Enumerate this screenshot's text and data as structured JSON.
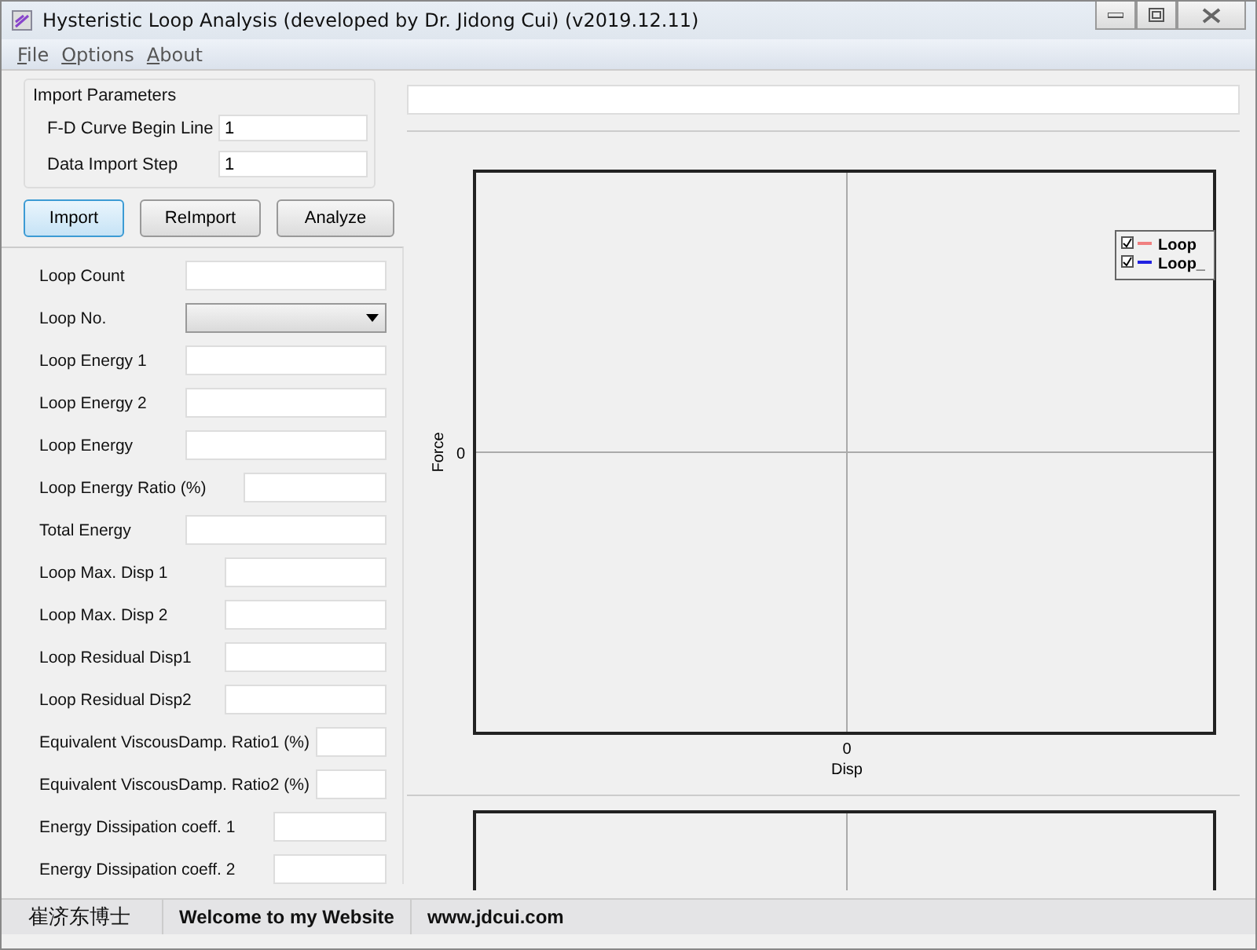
{
  "window": {
    "title": "Hysteristic Loop Analysis (developed by Dr. Jidong Cui) (v2019.12.11)"
  },
  "menu": [
    {
      "label": "File"
    },
    {
      "label": "Options"
    },
    {
      "label": "About"
    }
  ],
  "import_parameters": {
    "title": "Import Parameters",
    "fields": [
      {
        "label": "F-D Curve Begin Line",
        "value": "1"
      },
      {
        "label": "Data Import Step",
        "value": "1"
      }
    ]
  },
  "buttons": [
    {
      "label": "Import",
      "selected": true
    },
    {
      "label": "ReImport",
      "selected": false
    },
    {
      "label": "Analyze",
      "selected": false
    }
  ],
  "results": [
    {
      "label": "Loop Count",
      "kind": "text"
    },
    {
      "label": "Loop No.",
      "kind": "dropdown"
    },
    {
      "label": "Loop Energy 1",
      "kind": "text"
    },
    {
      "label": "Loop Energy 2",
      "kind": "text"
    },
    {
      "label": "Loop Energy",
      "kind": "text"
    },
    {
      "label": "Loop Energy Ratio (%)",
      "kind": "text"
    },
    {
      "label": "Total Energy",
      "kind": "text"
    },
    {
      "label": "Loop Max. Disp 1",
      "kind": "text"
    },
    {
      "label": "Loop Max. Disp 2",
      "kind": "text"
    },
    {
      "label": "Loop Residual Disp1",
      "kind": "text"
    },
    {
      "label": "Loop Residual Disp2",
      "kind": "text"
    },
    {
      "label": "Equivalent ViscousDamp. Ratio1 (%)",
      "kind": "text"
    },
    {
      "label": "Equivalent ViscousDamp. Ratio2 (%)",
      "kind": "text"
    },
    {
      "label": "Energy Dissipation coeff. 1",
      "kind": "text"
    },
    {
      "label": "Energy Dissipation coeff. 2",
      "kind": "text"
    }
  ],
  "chart": {
    "xlabel": "Disp",
    "ylabel": "Force",
    "xtick": "0",
    "ytick": "0",
    "legend": [
      {
        "label": "Loop",
        "checked": true,
        "color": "#f08080"
      },
      {
        "label": "Loop_",
        "checked": true,
        "color": "#2020e0"
      }
    ]
  },
  "status_bar": [
    "崔济东博士",
    "Welcome to my Website",
    "www.jdcui.com"
  ]
}
